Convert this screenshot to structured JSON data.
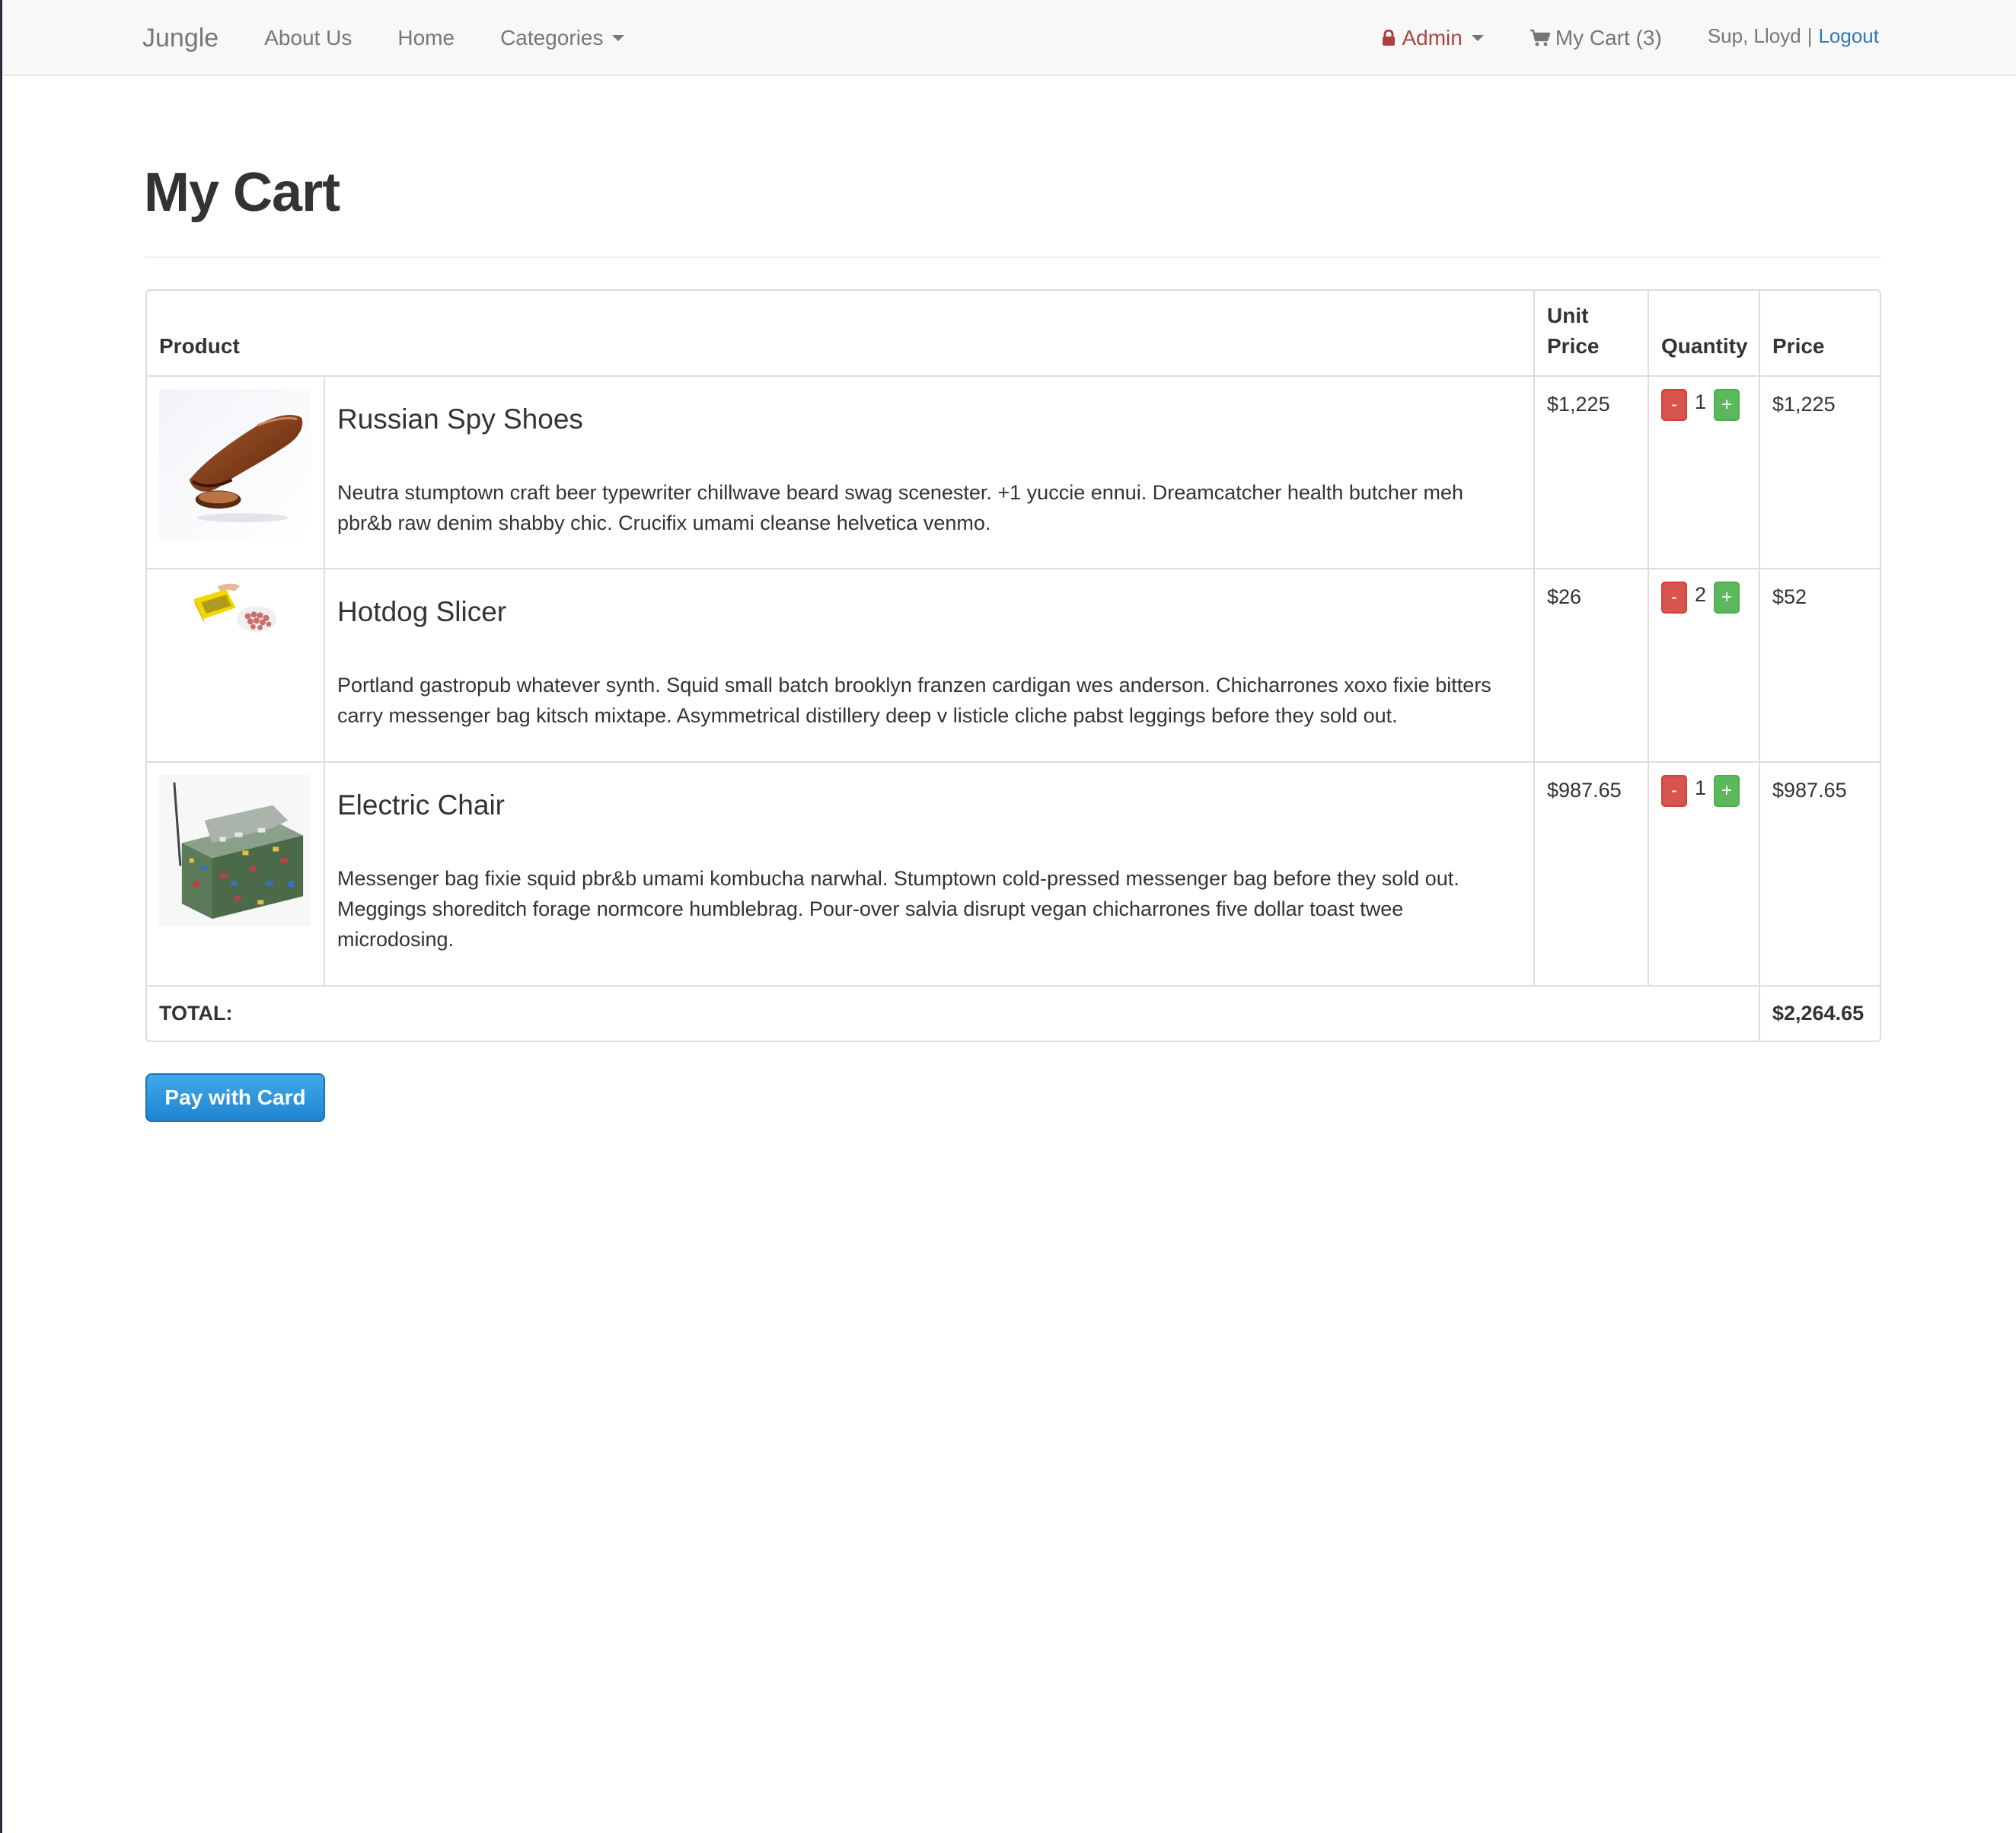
{
  "navbar": {
    "brand": "Jungle",
    "links": [
      "About Us",
      "Home",
      "Categories"
    ],
    "admin_label": "Admin",
    "cart_label": "My Cart (3)",
    "greeting": "Sup, Lloyd",
    "separator": "|",
    "logout_label": "Logout",
    "colors": {
      "admin": "#a94442",
      "logout": "#337ab7",
      "muted": "#777777"
    }
  },
  "page": {
    "title": "My Cart"
  },
  "table": {
    "headers": {
      "product": "Product",
      "unit_price": "Unit Price",
      "quantity": "Quantity",
      "price": "Price"
    },
    "rows": [
      {
        "name": "Russian Spy Shoes",
        "description": "Neutra stumptown craft beer typewriter chillwave beard swag scenester. +1 yuccie ennui. Dreamcatcher health butcher meh pbr&b raw denim shabby chic. Crucifix umami cleanse helvetica venmo.",
        "unit_price": "$1,225",
        "quantity": "1",
        "price": "$1,225",
        "image_icon": "shoe-image"
      },
      {
        "name": "Hotdog Slicer",
        "description": "Portland gastropub whatever synth. Squid small batch brooklyn franzen cardigan wes anderson. Chicharrones xoxo fixie bitters carry messenger bag kitsch mixtape. Asymmetrical distillery deep v listicle cliche pabst leggings before they sold out.",
        "unit_price": "$26",
        "quantity": "2",
        "price": "$52",
        "image_icon": "slicer-image"
      },
      {
        "name": "Electric Chair",
        "description": "Messenger bag fixie squid pbr&b umami kombucha narwhal. Stumptown cold-pressed messenger bag before they sold out. Meggings shoreditch forage normcore humblebrag. Pour-over salvia disrupt vegan chicharrones five dollar toast twee microdosing.",
        "unit_price": "$987.65",
        "quantity": "1",
        "price": "$987.65",
        "image_icon": "chair-image"
      }
    ],
    "minus_label": "-",
    "plus_label": "+",
    "total_label": "TOTAL:",
    "total_value": "$2,264.65"
  },
  "actions": {
    "pay_label": "Pay with Card",
    "pay_color": "#2a8fdb"
  }
}
